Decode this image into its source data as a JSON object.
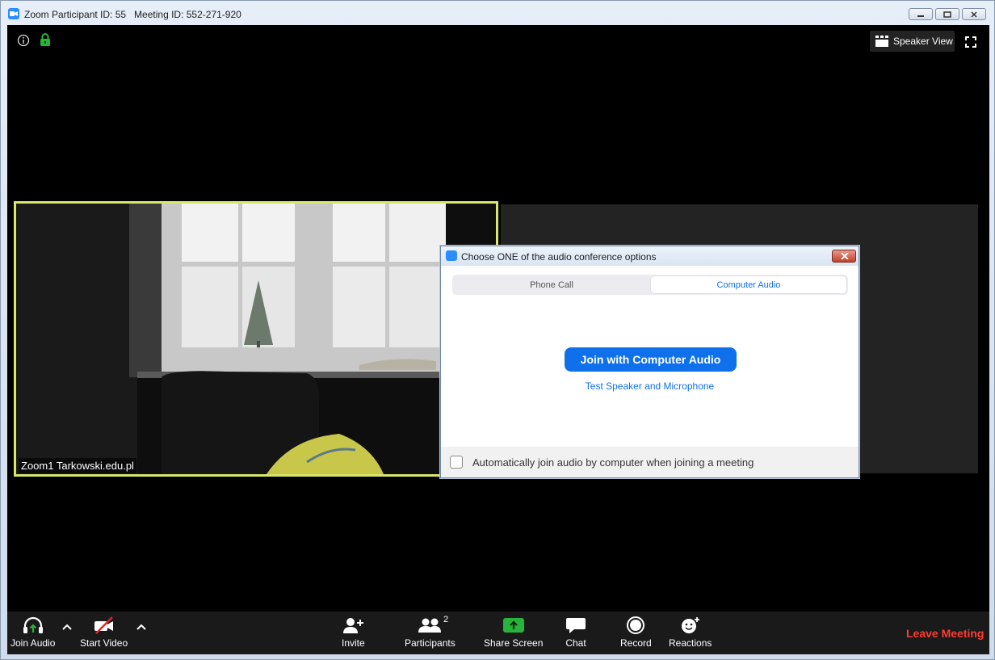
{
  "window": {
    "title": "Zoom Participant ID: 55   Meeting ID: 552-271-920"
  },
  "meeting": {
    "view_button_label": "Speaker View",
    "video_name_tag": "Zoom1 Tarkowski.edu.pl"
  },
  "toolbar": {
    "join_audio": "Join Audio",
    "start_video": "Start Video",
    "invite": "Invite",
    "participants": "Participants",
    "participants_count": "2",
    "share_screen": "Share Screen",
    "chat": "Chat",
    "record": "Record",
    "reactions": "Reactions",
    "leave_meeting": "Leave Meeting",
    "share_color": "#27b43a",
    "leave_color": "#ff3b30"
  },
  "dialog": {
    "title": "Choose ONE of the audio conference options",
    "tabs": [
      "Phone Call",
      "Computer Audio"
    ],
    "selected_tab": "Computer Audio",
    "join_button": "Join with Computer Audio",
    "test_link": "Test Speaker and Microphone",
    "auto_join_label": "Automatically join audio by computer when joining a meeting",
    "auto_join_checked": false,
    "accent_color": "#0e71eb"
  },
  "icons": [
    "zoom-logo-icon",
    "info-icon",
    "lock-icon",
    "speaker-view-icon",
    "fullscreen-icon",
    "headphones-icon",
    "video-off-icon",
    "chevron-up-icon",
    "add-person-icon",
    "participants-icon",
    "share-screen-icon",
    "chat-icon",
    "record-icon",
    "reactions-icon",
    "close-icon",
    "minimize-icon",
    "maximize-icon"
  ]
}
